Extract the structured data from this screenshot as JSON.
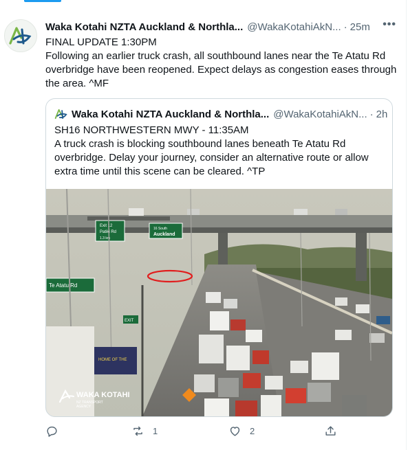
{
  "tweet": {
    "author_name": "Waka Kotahi NZTA Auckland & Northla...",
    "handle": "@WakaKotahiAkN...",
    "separator": "·",
    "time": "25m",
    "more_label": "•••",
    "lines": [
      "FINAL UPDATE 1:30PM",
      "Following an earlier truck crash, all southbound lanes near the Te Atatu Rd overbridge have been reopened. Expect delays as congestion eases through the area. ^MF"
    ]
  },
  "quoted_tweet": {
    "author_name": "Waka Kotahi NZTA Auckland & Northla...",
    "handle": "@WakaKotahiAkN...",
    "separator": "·",
    "time": "2h",
    "lines": [
      "SH16 NORTHWESTERN MWY - 11:35AM",
      "A truck crash is blocking southbound lanes beneath Te Atatu Rd overbridge. Delay your journey, consider an alternative route or allow extra time until this scene can be cleared. ^TP"
    ],
    "image": {
      "sign_exit_number": "Exit 12",
      "sign_left_text": "Patiki Rd",
      "sign_left_distance": "1.3 km",
      "sign_right_route": "16 South",
      "sign_right_text": "Auckland",
      "sign_te_atatu": "Te Atatu Rd",
      "exit_label": "EXIT",
      "watermark_brand": "WAKA KOTAHI",
      "watermark_sub1": "NZ TRANSPORT",
      "watermark_sub2": "AGENCY",
      "store_sign": "HOME OF THE"
    }
  },
  "actions": {
    "reply_count": "",
    "retweet_count": "1",
    "like_count": "2",
    "share_count": ""
  },
  "colors": {
    "accent": "#1d9bf0",
    "text": "#0f1419",
    "muted": "#536471",
    "logo_green": "#7ab648",
    "logo_blue": "#1e5a8c"
  },
  "icons": [
    "reply-icon",
    "retweet-icon",
    "like-icon",
    "share-icon",
    "more-icon"
  ]
}
